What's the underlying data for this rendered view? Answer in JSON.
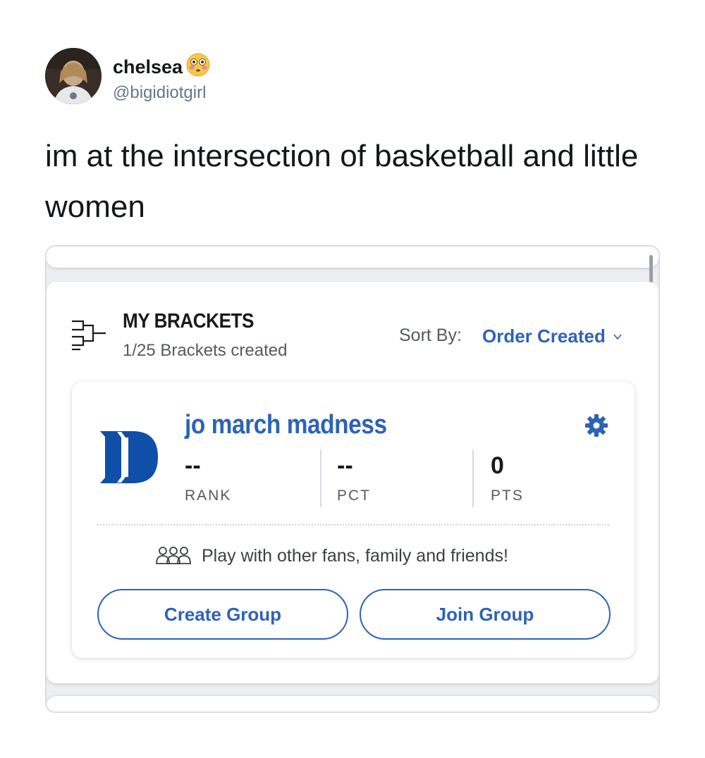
{
  "tweet": {
    "author": {
      "display_name": "chelsea",
      "emoji": "flushed-face-emoji",
      "handle": "@bigidiotgirl"
    },
    "text": "im at the intersection of basketball and little women"
  },
  "bracket_app": {
    "header": {
      "title": "MY BRACKETS",
      "subtitle": "1/25 Brackets created",
      "sort_label": "Sort By:",
      "sort_value": "Order Created"
    },
    "bracket_card": {
      "name": "jo march madness",
      "team_logo": "duke-d-logo",
      "stats": [
        {
          "value": "--",
          "label": "RANK"
        },
        {
          "value": "--",
          "label": "PCT"
        },
        {
          "value": "0",
          "label": "PTS"
        }
      ],
      "group_prompt": "Play with other fans, family and friends!",
      "create_group_label": "Create Group",
      "join_group_label": "Join Group"
    }
  },
  "colors": {
    "accent_blue": "#2d63b6",
    "duke_blue": "#0f4fa8",
    "handle_gray": "#657786",
    "text_dark": "#14171a"
  }
}
